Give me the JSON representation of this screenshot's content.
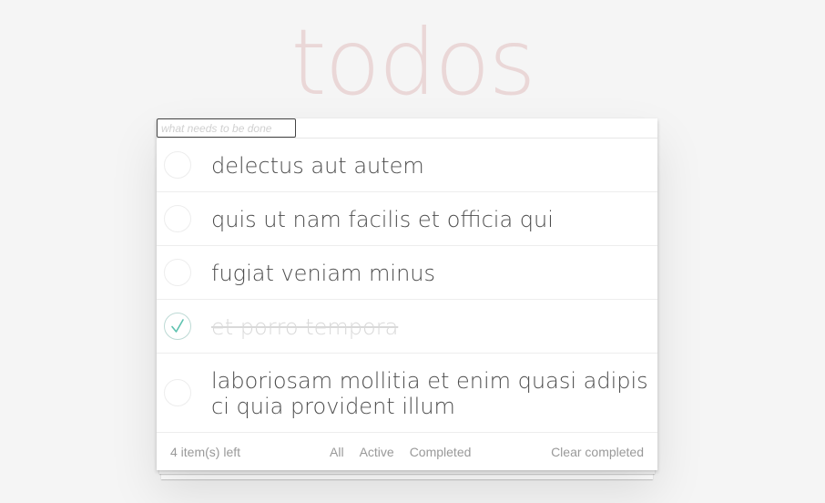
{
  "app": {
    "title": "todos"
  },
  "new_todo": {
    "placeholder": "what needs to be done"
  },
  "todos": [
    {
      "label": "delectus aut autem",
      "completed": false
    },
    {
      "label": "quis ut nam facilis et officia qui",
      "completed": false
    },
    {
      "label": "fugiat veniam minus",
      "completed": false
    },
    {
      "label": "et porro tempora",
      "completed": true
    },
    {
      "label": "laboriosam mollitia et enim quasi adipisci quia provident illum",
      "completed": false
    }
  ],
  "footer": {
    "count": "4 item(s) left",
    "filters": [
      "All",
      "Active",
      "Completed"
    ],
    "clear": "Clear completed"
  },
  "colors": {
    "check": "#5dc2af",
    "title": "#ead7d7"
  }
}
